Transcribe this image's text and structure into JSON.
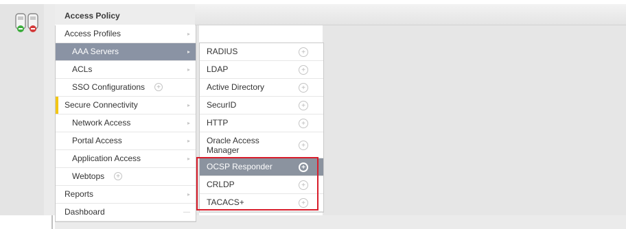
{
  "app": {
    "title": "Access Policy"
  },
  "menu_level1": [
    {
      "label": "Access Profiles",
      "kind": "top",
      "has_arrow": true
    },
    {
      "label": "AAA Servers",
      "kind": "sub",
      "has_arrow": true,
      "selected": true
    },
    {
      "label": "ACLs",
      "kind": "sub",
      "has_arrow": true
    },
    {
      "label": "SSO Configurations",
      "kind": "sub",
      "has_plus": true
    },
    {
      "label": "Secure Connectivity",
      "kind": "top",
      "has_arrow": true,
      "marker": "yellow"
    },
    {
      "label": "Network Access",
      "kind": "sub",
      "has_arrow": true
    },
    {
      "label": "Portal Access",
      "kind": "sub",
      "has_arrow": true
    },
    {
      "label": "Application Access",
      "kind": "sub",
      "has_arrow": true
    },
    {
      "label": "Webtops",
      "kind": "sub",
      "has_plus": true
    },
    {
      "label": "Reports",
      "kind": "top",
      "has_arrow": true
    },
    {
      "label": "Dashboard",
      "kind": "top",
      "has_pin": true
    }
  ],
  "menu_level2": [
    {
      "label": "RADIUS"
    },
    {
      "label": "LDAP"
    },
    {
      "label": "Active Directory"
    },
    {
      "label": "SecurID"
    },
    {
      "label": "HTTP"
    },
    {
      "label": "Oracle Access Manager",
      "tall": true
    },
    {
      "label": "OCSP Responder",
      "active": true
    },
    {
      "label": "CRLDP"
    },
    {
      "label": "TACACS+"
    }
  ],
  "icons": {
    "arrow": "chevron-right-icon",
    "plus": "add-circle-icon",
    "pin": "pin-icon",
    "app": "status-app-icon"
  },
  "colors": {
    "selected_bg": "#8a93a4",
    "highlight_border": "#d81c2a",
    "marker": "#f3c614"
  }
}
